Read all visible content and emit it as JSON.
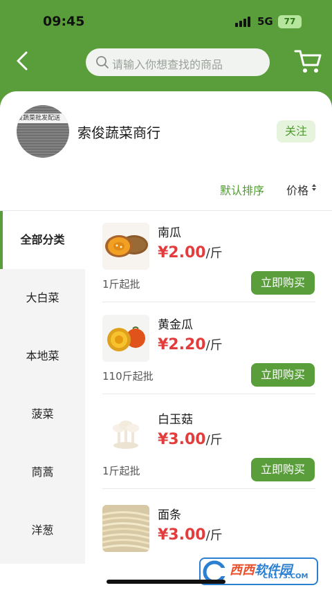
{
  "status_bar": {
    "time": "09:45",
    "network": "5G",
    "battery": "77"
  },
  "header": {
    "search_placeholder": "请输入你想查找的商品"
  },
  "shop": {
    "name": "索俊蔬菜商行",
    "follow_label": "关注",
    "avatar_banner_text": "俊蔬菜批发配送"
  },
  "sort": {
    "default_label": "默认排序",
    "price_label": "价格"
  },
  "categories": [
    {
      "label": "全部分类",
      "active": true
    },
    {
      "label": "大白菜",
      "active": false
    },
    {
      "label": "本地菜",
      "active": false
    },
    {
      "label": "菠菜",
      "active": false
    },
    {
      "label": "茼蒿",
      "active": false
    },
    {
      "label": "洋葱",
      "active": false
    }
  ],
  "products": [
    {
      "name": "南瓜",
      "price": "¥2.00",
      "unit": "/斤",
      "min_qty": "1斤起批",
      "buy_label": "立即购买"
    },
    {
      "name": "黄金瓜",
      "price": "¥2.20",
      "unit": "/斤",
      "min_qty": "110斤起批",
      "buy_label": "立即购买"
    },
    {
      "name": "白玉菇",
      "price": "¥3.00",
      "unit": "/斤",
      "min_qty": "1斤起批",
      "buy_label": "立即购买"
    },
    {
      "name": "面条",
      "price": "¥3.00",
      "unit": "/斤"
    }
  ],
  "watermark": {
    "logo": "西西",
    "sub": "CR173.COM",
    "text": "软件园"
  },
  "colors": {
    "brand_green": "#5a9e3c",
    "price_red": "#e23c3c"
  }
}
